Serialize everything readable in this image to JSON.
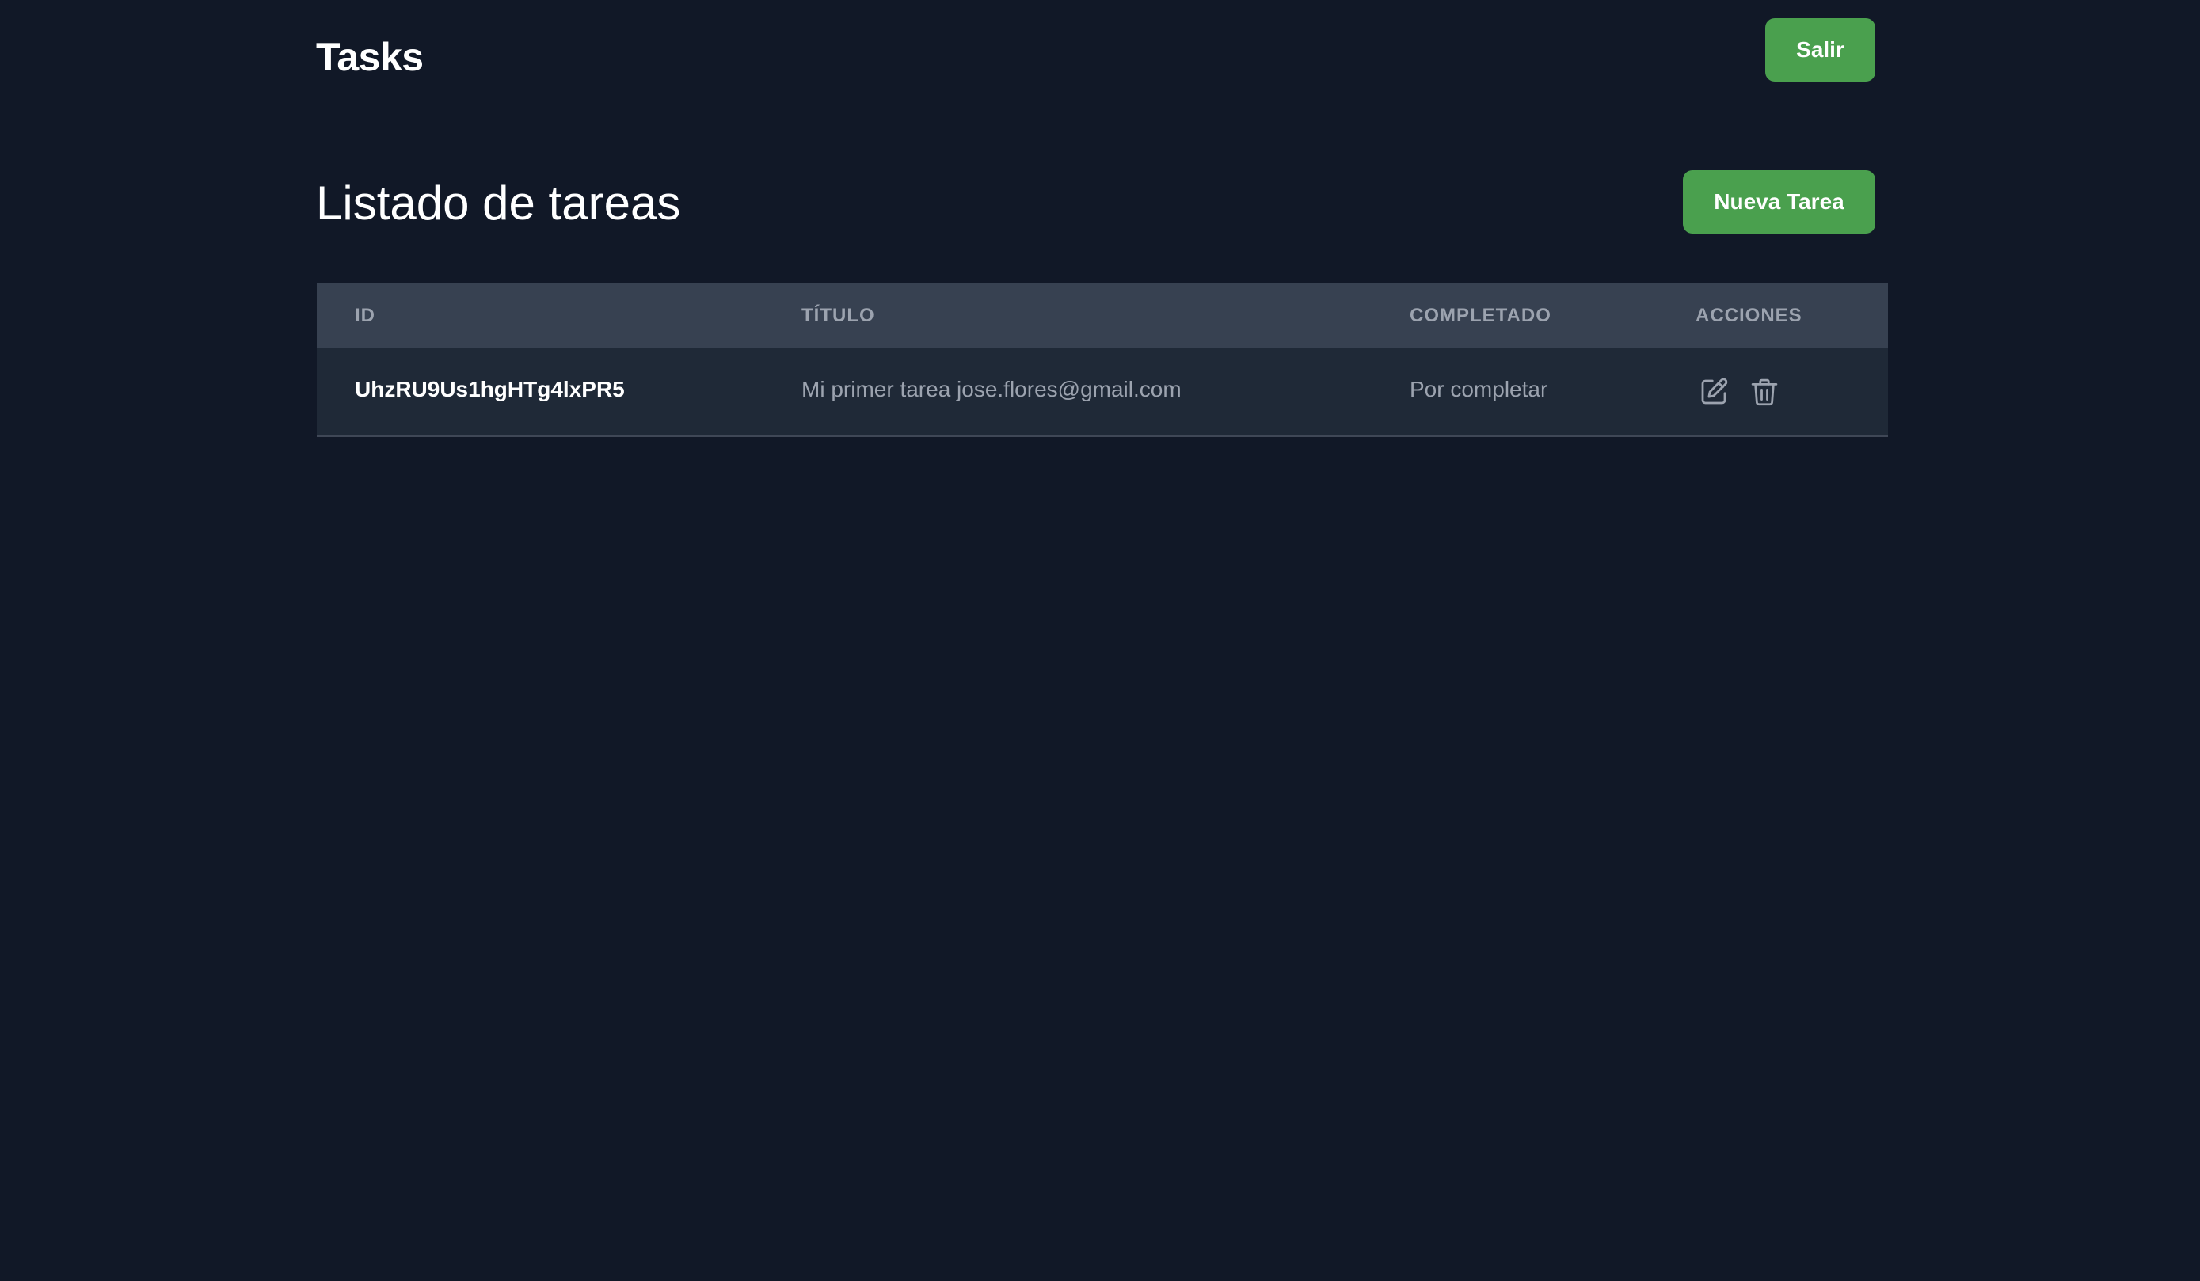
{
  "header": {
    "brand": "Tasks",
    "logout_label": "Salir"
  },
  "main": {
    "title": "Listado de tareas",
    "new_task_label": "Nueva Tarea"
  },
  "table": {
    "columns": [
      "ID",
      "TÍTULO",
      "COMPLETADO",
      "ACCIONES"
    ],
    "rows": [
      {
        "id": "UhzRU9Us1hgHTg4lxPR5",
        "title": "Mi primer tarea jose.flores@gmail.com",
        "status": "Por completar",
        "actions": [
          "edit-icon",
          "trash-icon"
        ]
      }
    ]
  },
  "colors": {
    "background": "#111827",
    "header_row": "#374151",
    "body_row": "#1f2937",
    "accent": "#4aa04e",
    "muted_text": "#9ca3af"
  }
}
